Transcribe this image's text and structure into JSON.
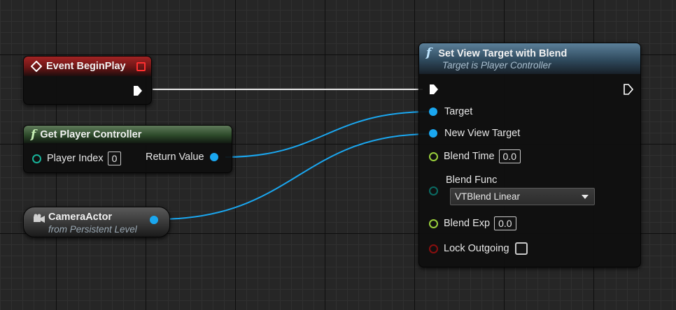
{
  "event_node": {
    "title": "Event BeginPlay",
    "color": "#a22424",
    "icon": "event-diamond-icon",
    "delegate_icon": "delegate-square-icon"
  },
  "player_controller_node": {
    "title": "Get Player Controller",
    "icon": "function-icon",
    "input_label": "Player Index",
    "input_value": "0",
    "output_label": "Return Value"
  },
  "camera_node": {
    "title": "CameraActor",
    "subtitle": "from Persistent Level",
    "icon": "camera-icon"
  },
  "set_view_node": {
    "title": "Set View Target with Blend",
    "subtitle": "Target is Player Controller",
    "icon": "function-icon",
    "pins": {
      "target": "Target",
      "new_view_target": "New View Target",
      "blend_time": "Blend Time",
      "blend_time_value": "0.0",
      "blend_func": "Blend Func",
      "blend_func_value": "VTBlend Linear",
      "blend_exp": "Blend Exp",
      "blend_exp_value": "0.0",
      "lock_outgoing": "Lock Outgoing"
    }
  },
  "colors": {
    "object_pin": "#1aa7f0",
    "float_pin": "#9ad03c",
    "enum_pin": "#0b6b63",
    "bool_pin": "#8a0f0f",
    "exec_wire": "#ffffff"
  }
}
